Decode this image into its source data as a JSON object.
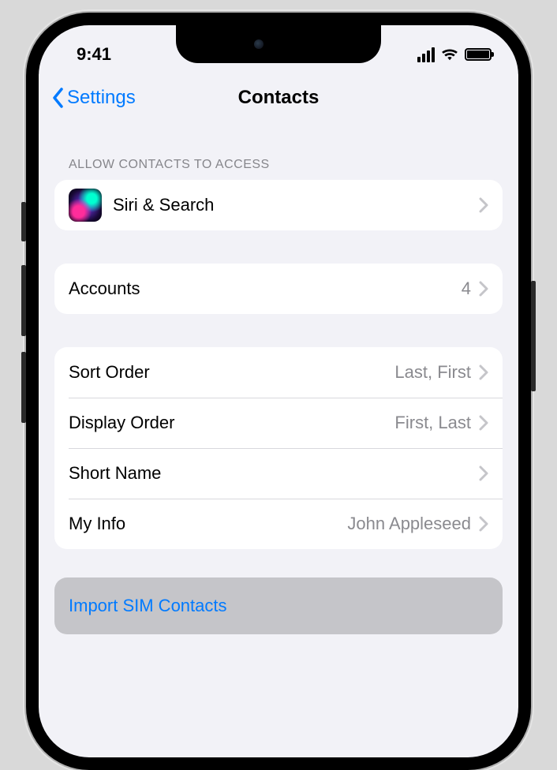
{
  "status": {
    "time": "9:41"
  },
  "nav": {
    "back_label": "Settings",
    "title": "Contacts"
  },
  "sections": {
    "access_header": "Allow Contacts to Access",
    "siri_label": "Siri & Search",
    "accounts": {
      "label": "Accounts",
      "count": "4"
    },
    "display": {
      "sort_order": {
        "label": "Sort Order",
        "value": "Last, First"
      },
      "display_order": {
        "label": "Display Order",
        "value": "First, Last"
      },
      "short_name": {
        "label": "Short Name"
      },
      "my_info": {
        "label": "My Info",
        "value": "John Appleseed"
      }
    },
    "import_label": "Import SIM Contacts"
  },
  "colors": {
    "accent": "#007aff",
    "background": "#f2f2f7",
    "secondary_text": "#8a8a8f"
  }
}
